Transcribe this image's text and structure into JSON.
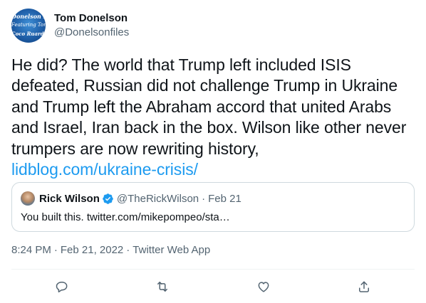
{
  "author": {
    "display_name": "Tom Donelson",
    "handle": "@Donelsonfiles",
    "avatar_lines": [
      "Donelson Files",
      "Featuring Tom Don",
      "Coco Ruards"
    ]
  },
  "tweet": {
    "lines": [
      "He did?  The world that Trump left included ISIS",
      "defeated, Russian did not challenge Trump in Ukraine",
      "and Trump left the Abraham accord that united Arabs",
      "and Israel, Iran back in the box.  Wilson like other never",
      "trumpers are now rewriting history,"
    ],
    "link": "lidblog.com/ukraine-crisis/"
  },
  "quote": {
    "display_name": "Rick Wilson",
    "handle": "@TheRickWilson",
    "separator": "·",
    "date": "Feb 21",
    "text": "You built this. twitter.com/mikepompeo/sta…"
  },
  "meta": {
    "time": "8:24 PM",
    "separator": "·",
    "date": "Feb 21, 2022",
    "separator2": "·",
    "source": "Twitter Web App"
  },
  "actions": {
    "icons": [
      "reply-icon",
      "retweet-icon",
      "like-icon",
      "share-icon"
    ]
  },
  "colors": {
    "link": "#1d9bf0",
    "secondary_text": "#536471",
    "border": "#cfd9de",
    "verified": "#1d9bf0"
  }
}
